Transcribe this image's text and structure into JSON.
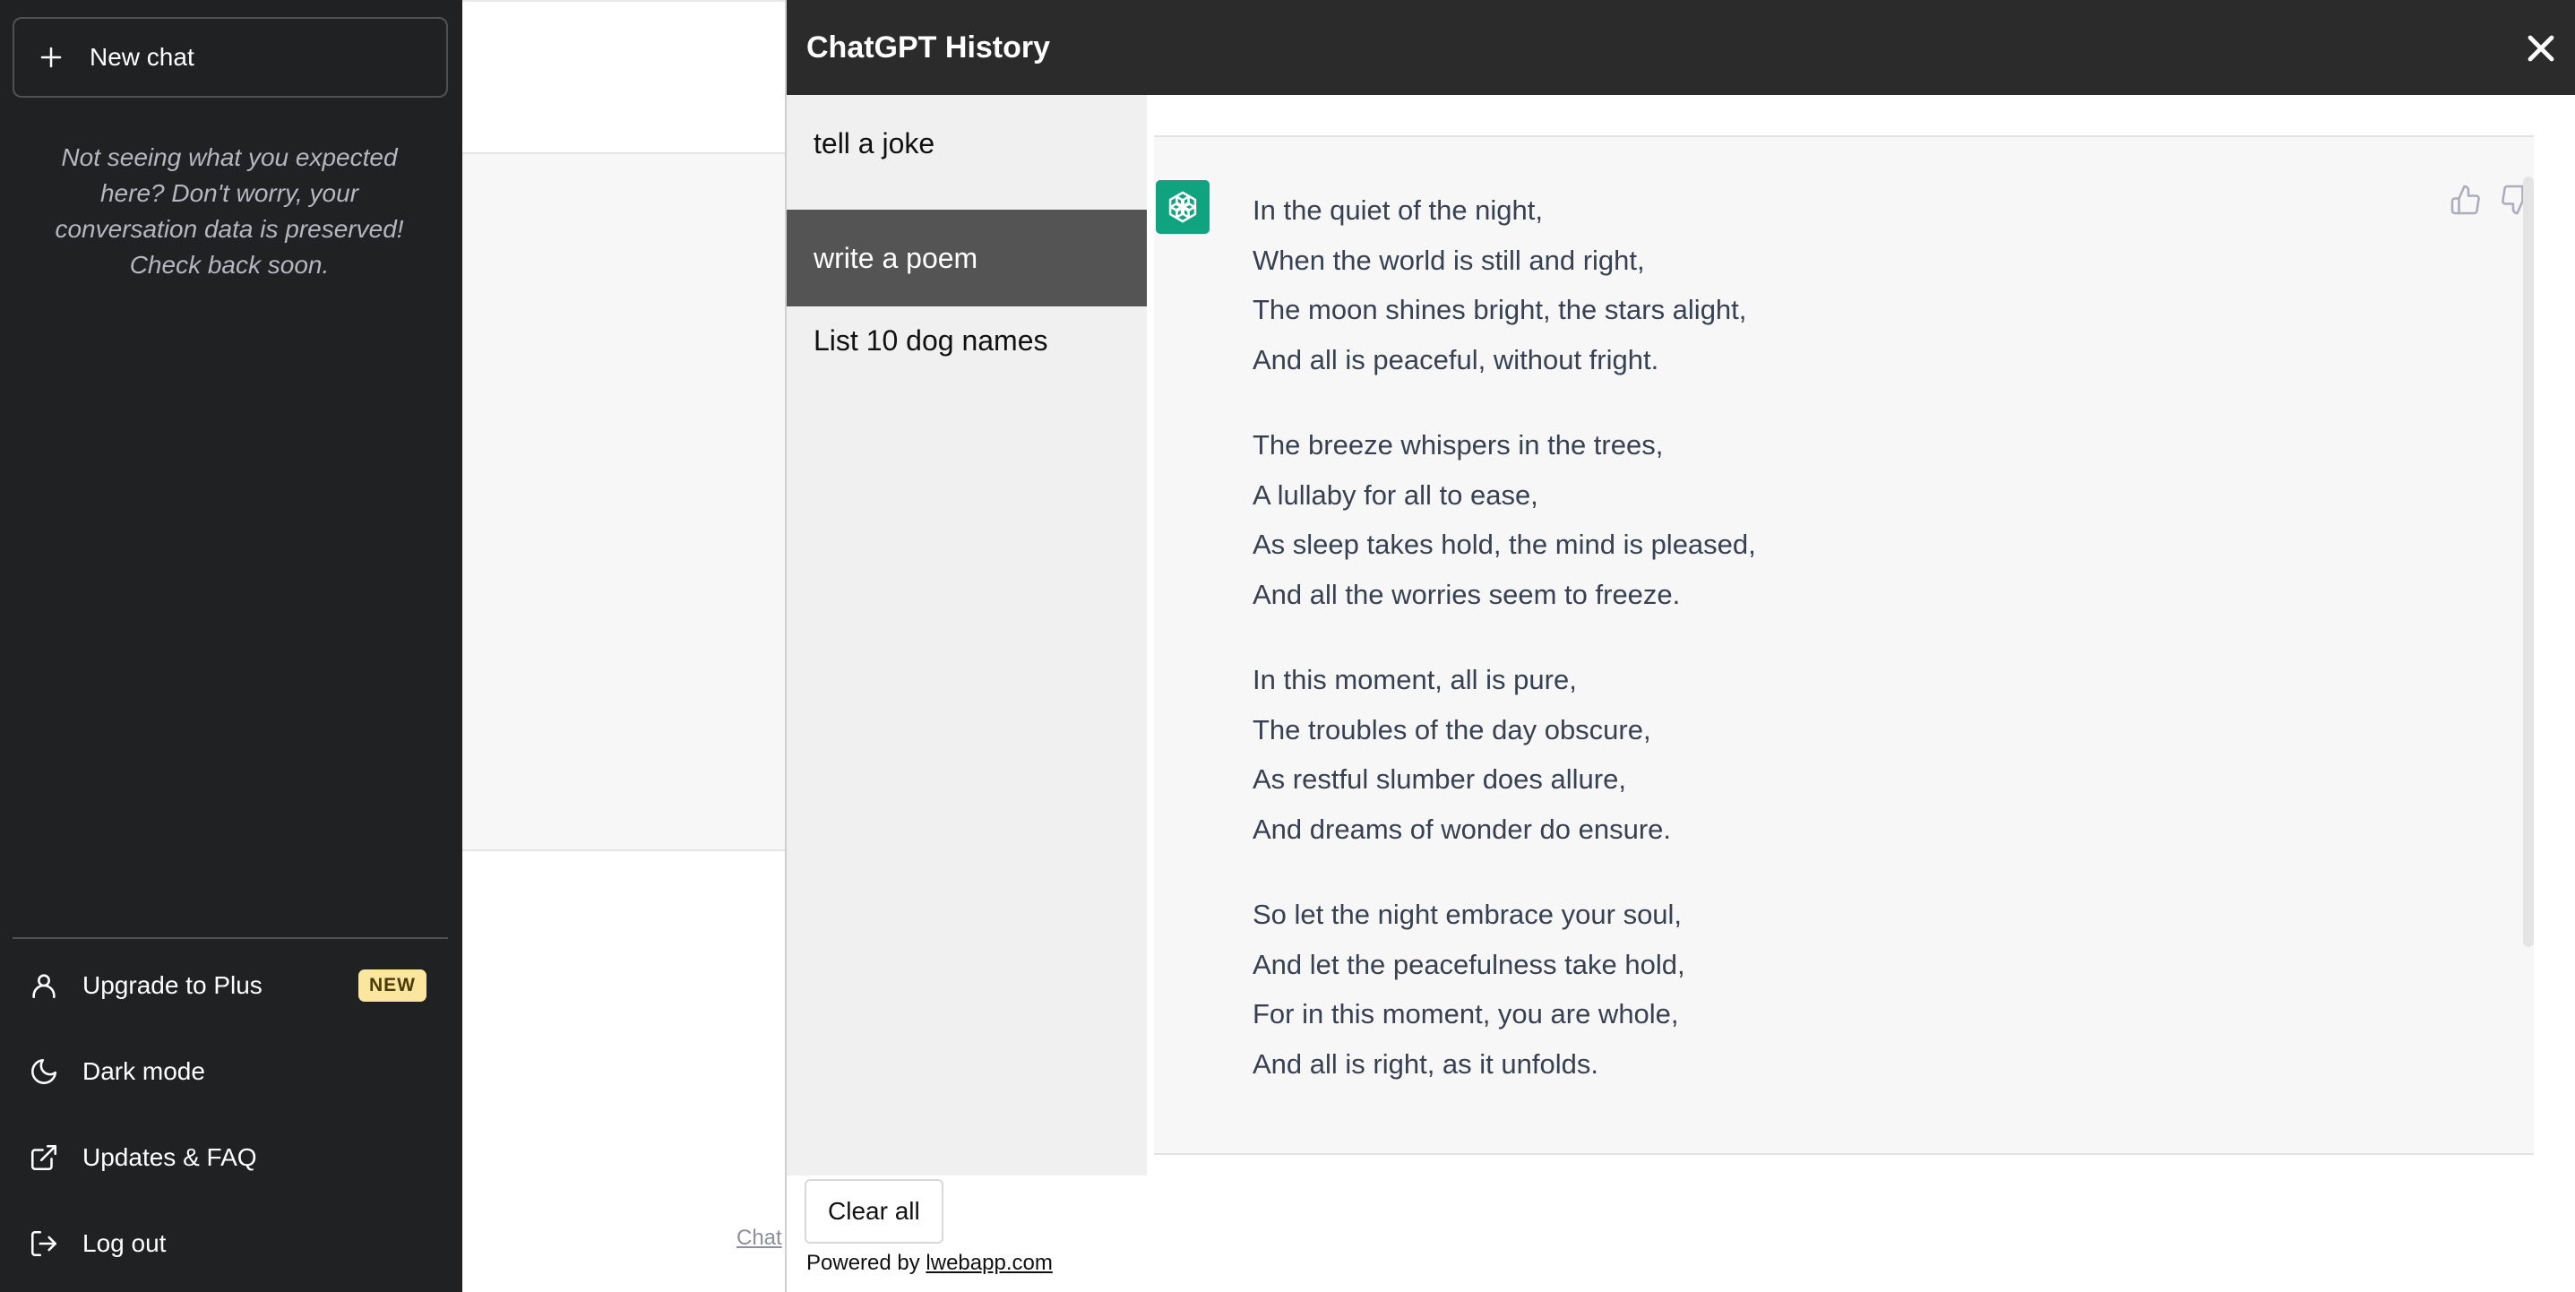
{
  "sidebar": {
    "new_chat_label": "New chat",
    "notice": "Not seeing what you expected here? Don't worry, your conversation data is preserved! Check back soon.",
    "items": [
      {
        "label": "Upgrade to Plus",
        "icon": "user-icon",
        "badge": "NEW"
      },
      {
        "label": "Dark mode",
        "icon": "moon-icon"
      },
      {
        "label": "Updates & FAQ",
        "icon": "external-link-icon"
      },
      {
        "label": "Log out",
        "icon": "logout-icon"
      }
    ]
  },
  "background": {
    "footer_link_fragment": "Chat"
  },
  "modal": {
    "title": "ChatGPT History",
    "conversations": [
      {
        "label": "tell a joke",
        "active": false
      },
      {
        "label": "write a poem",
        "active": true
      },
      {
        "label": "List 10 dog names",
        "active": false
      }
    ],
    "message": {
      "stanzas": [
        [
          "In the quiet of the night,",
          "When the world is still and right,",
          "The moon shines bright, the stars alight,",
          "And all is peaceful, without fright."
        ],
        [
          "The breeze whispers in the trees,",
          "A lullaby for all to ease,",
          "As sleep takes hold, the mind is pleased,",
          "And all the worries seem to freeze."
        ],
        [
          "In this moment, all is pure,",
          "The troubles of the day obscure,",
          "As restful slumber does allure,",
          "And dreams of wonder do ensure."
        ],
        [
          "So let the night embrace your soul,",
          "And let the peacefulness take hold,",
          "For in this moment, you are whole,",
          "And all is right, as it unfolds."
        ]
      ]
    },
    "clear_all_label": "Clear all",
    "powered_by_prefix": "Powered by",
    "powered_by_link": "lwebapp.com"
  },
  "colors": {
    "sidebar_bg": "#202123",
    "header_bg": "#2b2b2b",
    "active_item_bg": "#545454",
    "avatar_green": "#10a37f",
    "badge_bg": "#fae69e"
  }
}
